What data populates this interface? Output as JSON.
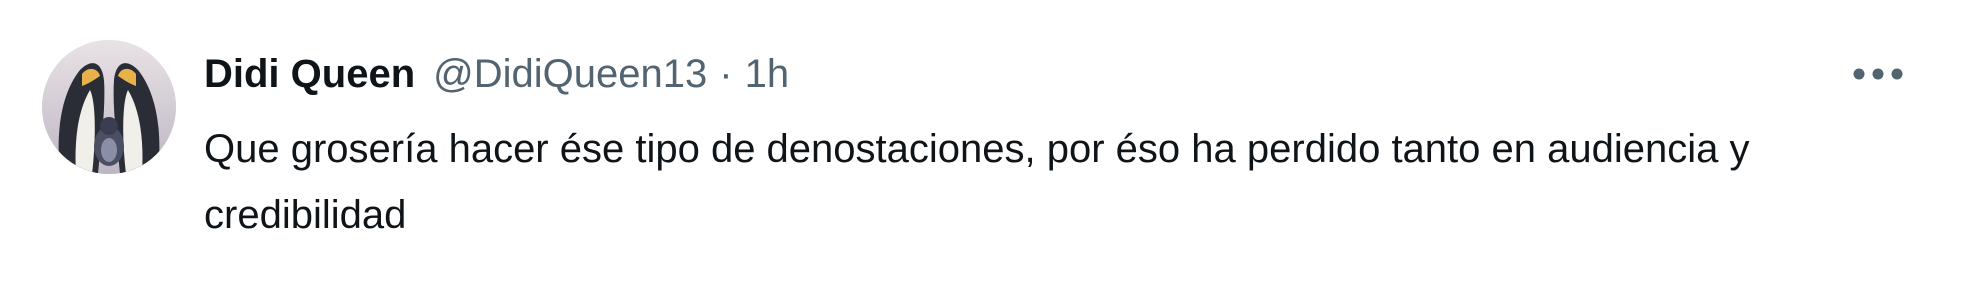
{
  "tweet": {
    "author": {
      "display_name": "Didi Queen",
      "handle": "@DidiQueen13",
      "avatar_icon": "penguin-avatar"
    },
    "separator": "·",
    "timestamp": "1h",
    "more_icon": "more-dots-icon",
    "text": "Que grosería hacer ése tipo de denostaciones, por éso ha perdido tanto en audiencia y credibilidad"
  },
  "colors": {
    "primary_text": "#0f1419",
    "secondary_text": "#536471",
    "background": "#ffffff"
  }
}
